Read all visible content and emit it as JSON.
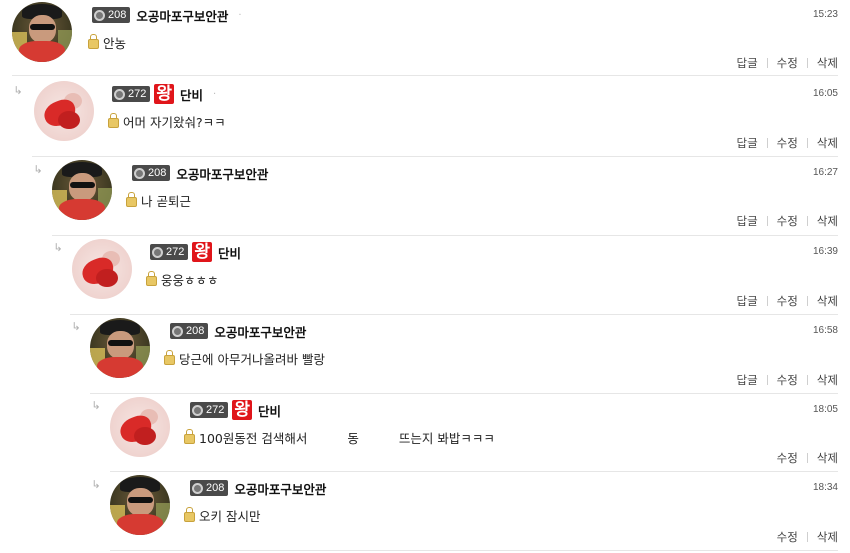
{
  "actions": {
    "reply": "답글",
    "edit": "수정",
    "delete": "삭제"
  },
  "comments": [
    {
      "level": "208",
      "king": "",
      "nickname": "오공마포구보안관",
      "time": "15:23",
      "text": "안농",
      "avatar": "man-sunglasses-avatar"
    },
    {
      "level": "272",
      "king": "왕",
      "nickname": "단비",
      "time": "16:05",
      "text": "어머 자기왔숴?ㅋㅋ",
      "avatar": "red-flower-avatar"
    },
    {
      "level": "208",
      "king": "",
      "nickname": "오공마포구보안관",
      "time": "16:27",
      "text": "나 곧퇴근",
      "avatar": "man-sunglasses-avatar"
    },
    {
      "level": "272",
      "king": "왕",
      "nickname": "단비",
      "time": "16:39",
      "text": "웅웅ㅎㅎㅎ",
      "avatar": "red-flower-avatar"
    },
    {
      "level": "208",
      "king": "",
      "nickname": "오공마포구보안관",
      "time": "16:58",
      "text": "당근에 아무거나올려바 빨랑",
      "avatar": "man-sunglasses-avatar"
    },
    {
      "level": "272",
      "king": "왕",
      "nickname": "단비",
      "time": "18:05",
      "text_a": "100원동전 검색해서",
      "text_b": "동",
      "text_c": "뜨는지 봐밥ㅋㅋㅋ",
      "avatar": "red-flower-avatar"
    },
    {
      "level": "208",
      "king": "",
      "nickname": "오공마포구보안관",
      "time": "18:34",
      "text": "오키 잠시만",
      "avatar": "man-sunglasses-avatar"
    }
  ]
}
